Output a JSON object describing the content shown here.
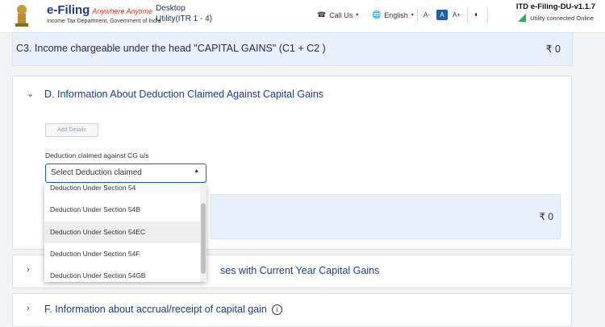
{
  "header": {
    "brand": "e-Filing",
    "tagline": "Anywhere Anytime",
    "dept": "Income Tax Department, Government of India",
    "util_line1": "Desktop",
    "util_line2": "Utility(ITR 1 - 4)",
    "call_us": "Call Us",
    "language": "English",
    "a_minus": "A-",
    "a_normal": "A",
    "a_plus": "A+",
    "version": "ITD e-Filing-DU-v1.1.7",
    "status": "Utility connected Online"
  },
  "c3": {
    "title": "C3. Income chargeable under the head \"CAPITAL GAINS\" (C1 + C2 )",
    "value": "₹ 0"
  },
  "section_d": {
    "title": "D. Information About Deduction Claimed Against Capital Gains",
    "add_details": "Add Details",
    "deduction_label": "Deduction claimed against CG u/s",
    "select_value": "Select Deduction claimed",
    "box_value": "₹ 0",
    "options": [
      "Deduction Under Section 54",
      "Deduction Under Section 54B",
      "Deduction Under Section 54EC",
      "Deduction Under Section 54F",
      "Deduction Under Section 54GB"
    ],
    "highlighted_option": "Deduction Under Section 54EC"
  },
  "section_e": {
    "title_visible": "ses with Current Year Capital Gains"
  },
  "section_f": {
    "title": "F. Information about accrual/receipt of capital gain"
  },
  "colors": {
    "brand_blue": "#1f3b86",
    "link_blue": "#1f5fa8",
    "panel_blue": "#e8f1fb",
    "online_green": "#2bb24c"
  }
}
